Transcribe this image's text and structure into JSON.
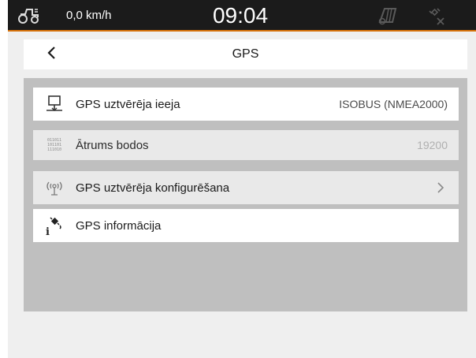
{
  "statusbar": {
    "speed": "0,0 km/h",
    "time": "09:04",
    "icons": [
      "tractor-icon",
      "field-icon",
      "gps-disabled-icon"
    ],
    "accent_color": "#d9730a"
  },
  "header": {
    "title": "GPS",
    "back_icon": "chevron-left-icon"
  },
  "menu": {
    "items": [
      {
        "icon": "receiver-input-icon",
        "label": "GPS uztvērēja ieeja",
        "value": "ISOBUS (NMEA2000)"
      },
      {
        "icon": "binary-data-icon",
        "label": "Ātrums bodos",
        "value": "19200",
        "binary": [
          "011011",
          "101101",
          "111010"
        ]
      },
      {
        "icon": "antenna-icon",
        "label": "GPS uztvērēja konfigurēšana",
        "chevron": "chevron-right-icon"
      },
      {
        "icon": "gps-info-icon",
        "label": "GPS informācija"
      }
    ]
  }
}
